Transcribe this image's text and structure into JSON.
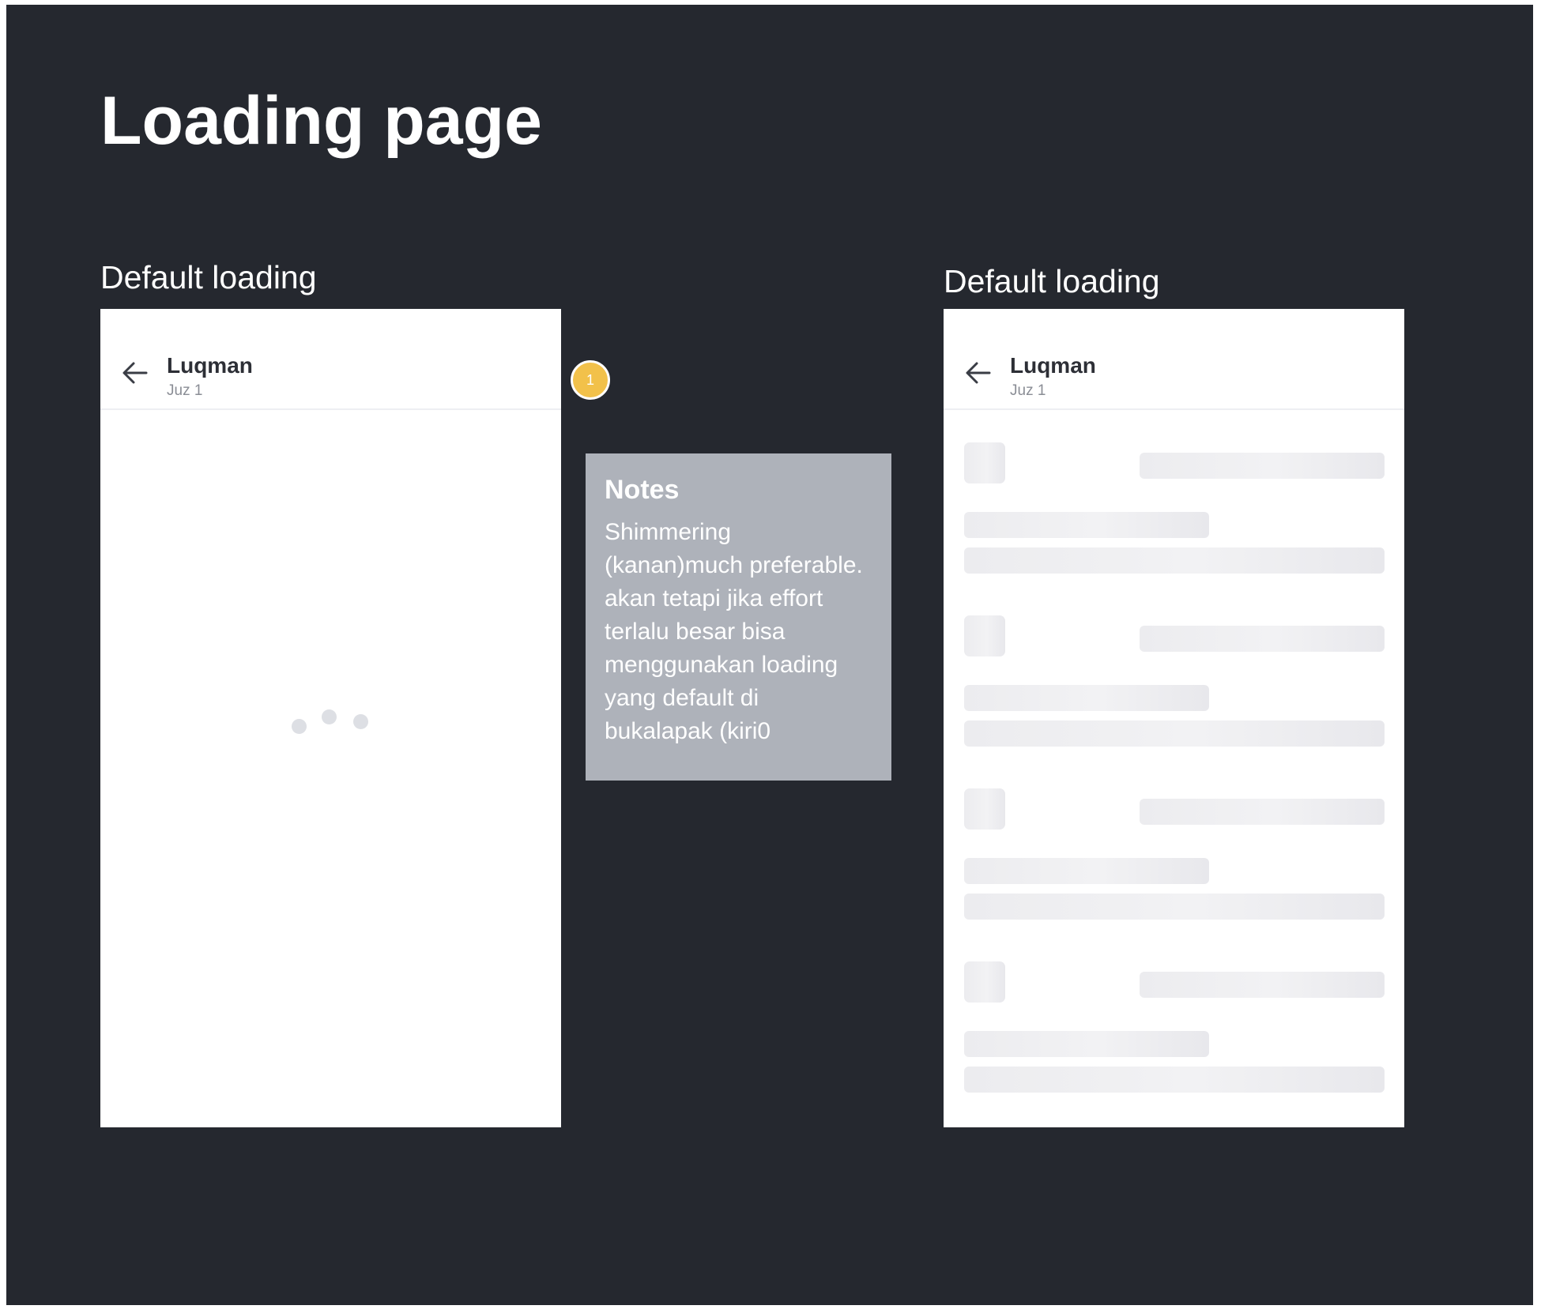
{
  "page": {
    "title": "Loading page"
  },
  "left_panel": {
    "label": "Default loading",
    "header": {
      "title": "Luqman",
      "subtitle": "Juz 1"
    },
    "loading_indicator": "three-dot-spinner"
  },
  "annotation": {
    "badge_number": "1",
    "notes_title": "Notes",
    "notes_body": "Shimmering\n(kanan)much preferable.\nakan tetapi jika effort\nterlalu besar bisa\nmenggunakan loading\nyang default di\nbukalapak (kiri0"
  },
  "right_panel": {
    "label": "Default loading",
    "header": {
      "title": "Luqman",
      "subtitle": "Juz 1"
    },
    "skeleton_groups": 4
  },
  "colors": {
    "background": "#25282f",
    "frame": "#ffffff",
    "badge": "#f2c14a",
    "notes": "#aeb2ba",
    "skeleton": "#ececef"
  },
  "icons": {
    "back": "arrow-left-icon",
    "spinner": "loading-dots-icon"
  }
}
